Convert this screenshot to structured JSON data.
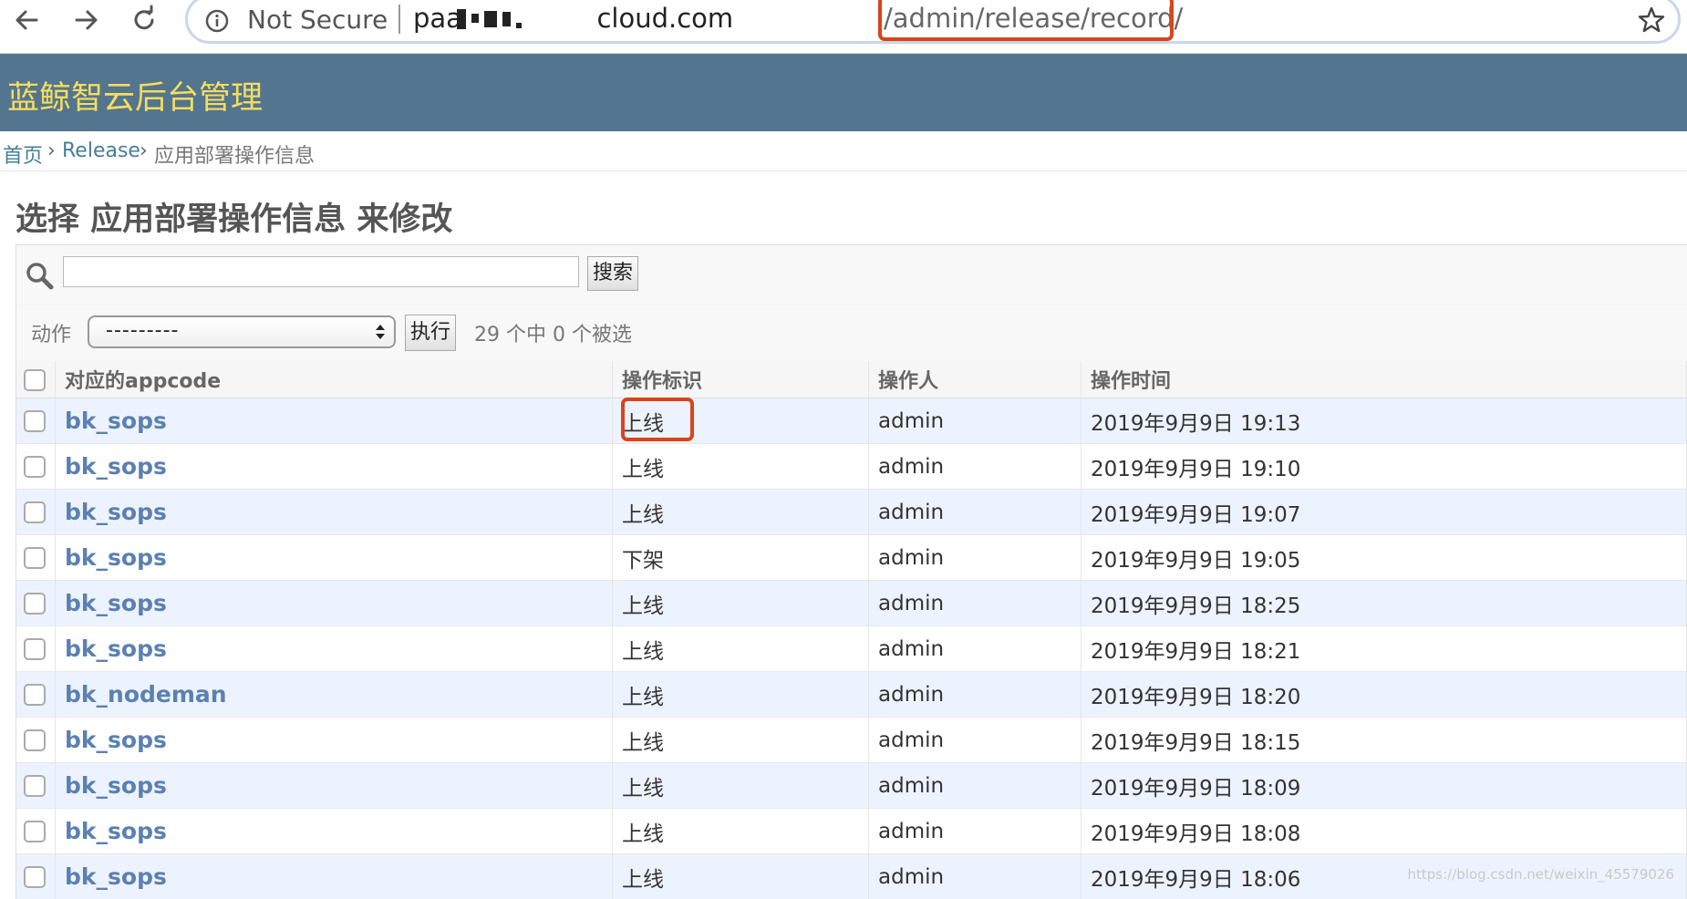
{
  "browser": {
    "security_label": "Not Secure",
    "url_host_start": "paa",
    "url_host_end": "cloud.com",
    "url_path": "/admin/release/record/"
  },
  "site": {
    "title": "蓝鲸智云后台管理"
  },
  "breadcrumbs": {
    "home": "首页",
    "sep": "›",
    "section": "Release",
    "current": "应用部署操作信息"
  },
  "page": {
    "title": "选择 应用部署操作信息 来修改"
  },
  "toolbar": {
    "search_button": "搜索",
    "search_value": ""
  },
  "actions": {
    "label": "动作",
    "selected": "---------",
    "run_button": "执行",
    "counter": "29 个中 0 个被选"
  },
  "table": {
    "headers": [
      "对应的appcode",
      "操作标识",
      "操作人",
      "操作时间"
    ],
    "rows": [
      {
        "appcode": "bk_sops",
        "flag": "上线",
        "user": "admin",
        "time": "2019年9月9日 19:13"
      },
      {
        "appcode": "bk_sops",
        "flag": "上线",
        "user": "admin",
        "time": "2019年9月9日 19:10"
      },
      {
        "appcode": "bk_sops",
        "flag": "上线",
        "user": "admin",
        "time": "2019年9月9日 19:07"
      },
      {
        "appcode": "bk_sops",
        "flag": "下架",
        "user": "admin",
        "time": "2019年9月9日 19:05"
      },
      {
        "appcode": "bk_sops",
        "flag": "上线",
        "user": "admin",
        "time": "2019年9月9日 18:25"
      },
      {
        "appcode": "bk_sops",
        "flag": "上线",
        "user": "admin",
        "time": "2019年9月9日 18:21"
      },
      {
        "appcode": "bk_nodeman",
        "flag": "上线",
        "user": "admin",
        "time": "2019年9月9日 18:20"
      },
      {
        "appcode": "bk_sops",
        "flag": "上线",
        "user": "admin",
        "time": "2019年9月9日 18:15"
      },
      {
        "appcode": "bk_sops",
        "flag": "上线",
        "user": "admin",
        "time": "2019年9月9日 18:09"
      },
      {
        "appcode": "bk_sops",
        "flag": "上线",
        "user": "admin",
        "time": "2019年9月9日 18:08"
      },
      {
        "appcode": "bk_sops",
        "flag": "上线",
        "user": "admin",
        "time": "2019年9月9日 18:06"
      }
    ]
  },
  "watermark": "https://blog.csdn.net/weixin_45579026",
  "colors": {
    "header_bg": "#54758f",
    "title_yellow": "#f5dd5d",
    "link_blue": "#5b80b2",
    "highlight_red": "#d9441a",
    "row_alt": "#edf3fe"
  }
}
